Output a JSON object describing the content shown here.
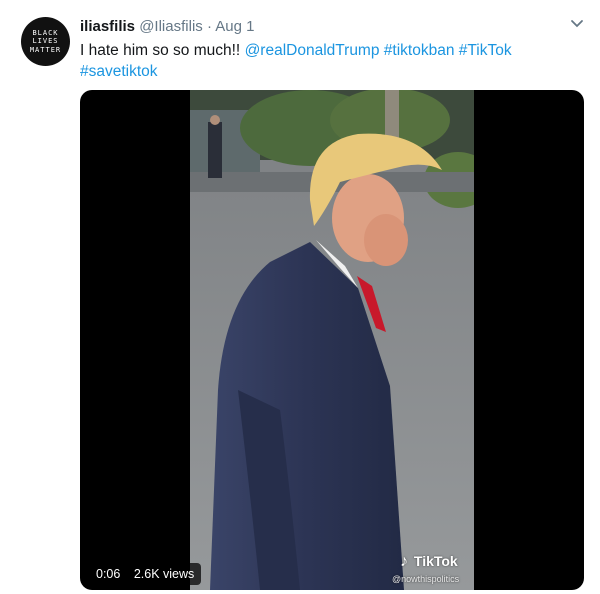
{
  "avatar": {
    "lines": [
      "BLACK",
      "LIVES",
      "MATTER"
    ]
  },
  "tweet": {
    "display_name": "iliasfilis",
    "handle": "@Iliasfilis",
    "separator": "·",
    "date": "Aug 1",
    "text": "I hate him so so much!!",
    "mention": "@realDonaldTrump",
    "hashtags": [
      "#tiktokban",
      "#TikTok",
      "#savetiktok"
    ]
  },
  "video": {
    "duration": "0:06",
    "views": "2.6K views",
    "watermark_brand": "TikTok",
    "watermark_user": "@nowthispolitics"
  },
  "colors": {
    "link": "#1b95e0",
    "name": "#14171a",
    "muted": "#657786"
  }
}
